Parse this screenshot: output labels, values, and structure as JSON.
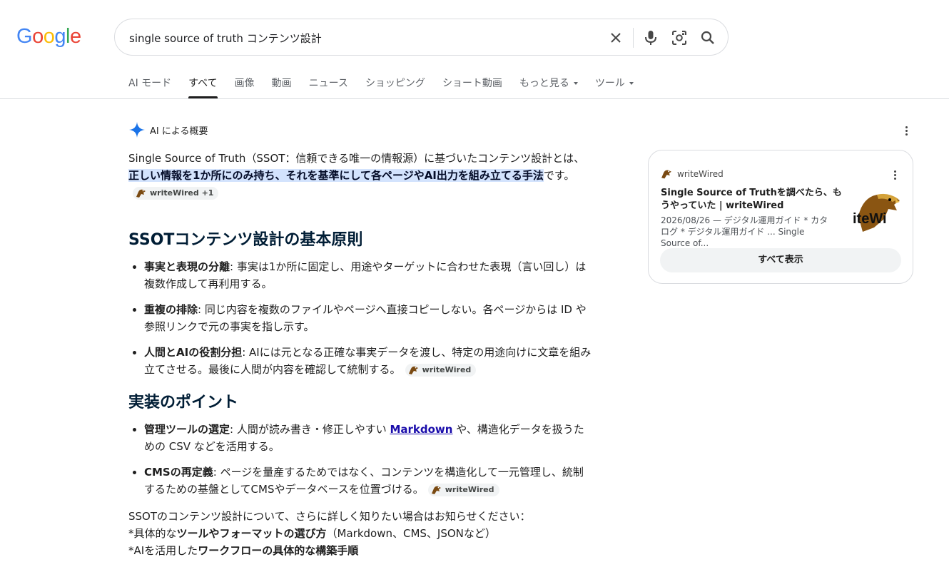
{
  "logo": {
    "text": "Google",
    "letters": [
      "G",
      "o",
      "o",
      "g",
      "l",
      "e"
    ],
    "colors": [
      "#4285f4",
      "#ea4335",
      "#fbbc05",
      "#4285f4",
      "#34a853",
      "#ea4335"
    ]
  },
  "search": {
    "query": "single source of truth コンテンツ設計",
    "icons": [
      "close-icon",
      "microphone-icon",
      "lens-icon",
      "search-icon"
    ]
  },
  "tabs": [
    {
      "label": "AI モード"
    },
    {
      "label": "すべて",
      "active": true
    },
    {
      "label": "画像"
    },
    {
      "label": "動画"
    },
    {
      "label": "ニュース"
    },
    {
      "label": "ショッピング"
    },
    {
      "label": "ショート動画"
    },
    {
      "label": "もっと見る",
      "dropdown": true
    },
    {
      "label": "ツール",
      "dropdown": true
    }
  ],
  "ai_overview": {
    "header": "AI による概要",
    "intro": {
      "before": "Single Source of Truth（SSOT：信頼できる唯一の情報源）に基づいたコンテンツ設計とは、",
      "highlight": "正しい情報を1か所にのみ持ち、それを基準にして各ページやAI出力を組み立てる手法",
      "after": "です。",
      "chip": "writeWired +1"
    },
    "section1": {
      "heading": "SSOTコンテンツ設計の基本原則",
      "items": [
        {
          "term": "事実と表現の分離",
          "text": ": 事実は1か所に固定し、用途やターゲットに合わせた表現（言い回し）は複数作成して再利用する。"
        },
        {
          "term": "重複の排除",
          "text": ": 同じ内容を複数のファイルやページへ直接コピーしない。各ページからは ID や参照リンクで元の事実を指し示す。"
        },
        {
          "term": "人間とAIの役割分担",
          "text": ": AIには元となる正確な事実データを渡し、特定の用途向けに文章を組み立てさせる。最後に人間が内容を確認して統制する。",
          "chip": "writeWired"
        }
      ]
    },
    "section2": {
      "heading": "実装のポイント",
      "items": [
        {
          "term": "管理ツールの選定",
          "text_before": ": 人間が読み書き・修正しやすい ",
          "link": "Markdown",
          "text_after": " や、構造化データを扱うための CSV などを活用する。"
        },
        {
          "term": "CMSの再定義",
          "text": ": ページを量産するためではなく、コンテンツを構造化して一元管理し、統制するための基盤としてCMSやデータベースを位置づける。",
          "chip": "writeWired"
        }
      ]
    },
    "followup": {
      "line1": "SSOTのコンテンツ設計について、さらに詳しく知りたい場合はお知らせください：",
      "line2_prefix": "*具体的な",
      "line2_bold": "ツールやフォーマットの選び方",
      "line2_suffix": "（Markdown、CMS、JSONなど）",
      "line3_prefix": "*AIを活用した",
      "line3_bold": "ワークフローの具体的な構築手順"
    }
  },
  "side_card": {
    "source": "writeWired",
    "title": "Single Source of Truthを調べたら、もうやっていた | writeWired",
    "snippet": "2026/08/26 — デジタル運用ガイド * カタログ * デジタル運用ガイド ... Single Source of...",
    "thumb_text": "iteWi",
    "show_all": "すべて表示"
  },
  "colors": {
    "accent_blue": "#1a73e8",
    "highlight": "#d3e3fd",
    "link": "#1a0dab",
    "heading": "#001d35"
  }
}
